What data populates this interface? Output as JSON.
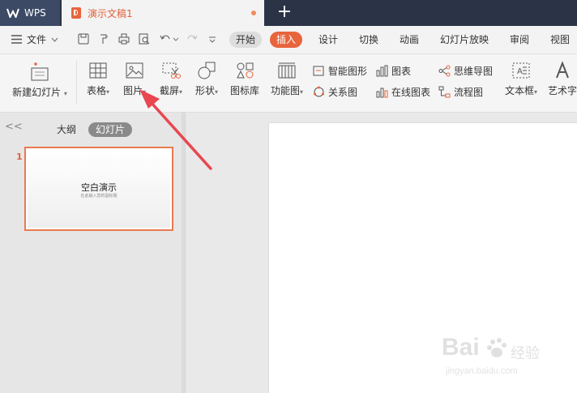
{
  "titlebar": {
    "app_label": "WPS",
    "doc_tab": "演示文稿1",
    "new_tab_symbol": "+"
  },
  "menubar": {
    "file": "文件",
    "tabs": [
      "开始",
      "插入",
      "设计",
      "切换",
      "动画",
      "幻灯片放映",
      "审阅",
      "视图"
    ],
    "active_tab": "插入"
  },
  "ribbon": {
    "new_slide": "新建幻灯片",
    "table": "表格",
    "picture": "图片",
    "screenshot": "截屏",
    "shape": "形状",
    "icon_lib": "图标库",
    "function_chart": "功能图",
    "smart_shape": "智能图形",
    "chart": "图表",
    "relation_chart": "关系图",
    "online_chart": "在线图表",
    "mind_map": "思维导图",
    "flowchart": "流程图",
    "text_box": "文本框",
    "word_art": "艺术字"
  },
  "panel": {
    "collapse_symbol": "<<",
    "tab_outline": "大纲",
    "tab_slides": "幻灯片",
    "slide_number": "1",
    "thumb_title": "空白演示",
    "thumb_subtitle": "在此输入您的副标题"
  },
  "watermark": {
    "brand": "Bai",
    "cn": "经验",
    "url": "jingyan.baidu.com"
  },
  "colors": {
    "accent": "#e8643c",
    "arrow": "#e8474f",
    "titlebar": "#2b3346"
  }
}
